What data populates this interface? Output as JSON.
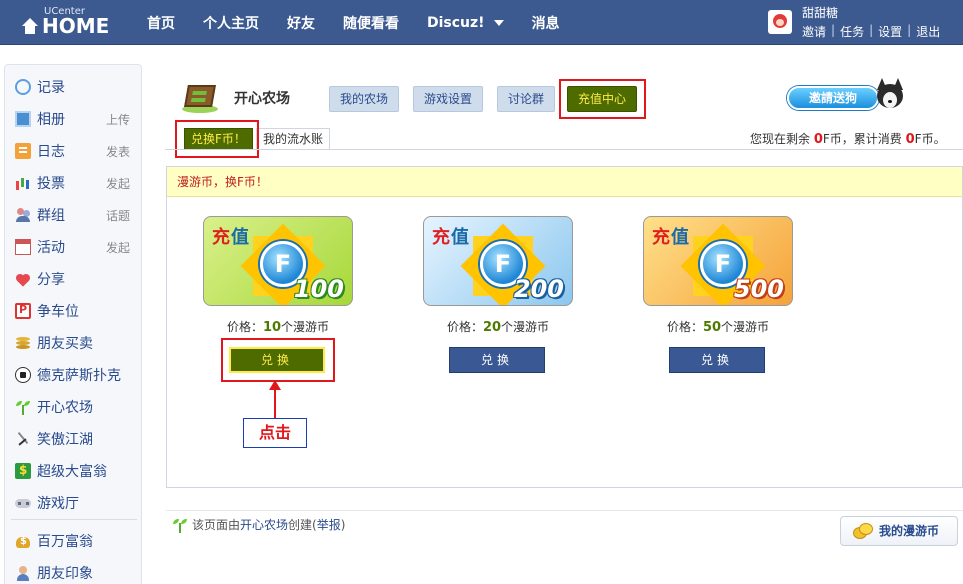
{
  "header": {
    "brand_small": "UCenter",
    "brand_large": "HOME",
    "nav": [
      {
        "label": "首页"
      },
      {
        "label": "个人主页"
      },
      {
        "label": "好友"
      },
      {
        "label": "随便看看"
      },
      {
        "label": "Discuz!"
      },
      {
        "label": "消息"
      }
    ],
    "user": {
      "name": "甜甜糖",
      "links": [
        "邀请",
        "任务",
        "设置",
        "退出"
      ]
    }
  },
  "sidebar": {
    "items": [
      {
        "label": "记录",
        "action": ""
      },
      {
        "label": "相册",
        "action": "上传"
      },
      {
        "label": "日志",
        "action": "发表"
      },
      {
        "label": "投票",
        "action": "发起"
      },
      {
        "label": "群组",
        "action": "话题"
      },
      {
        "label": "活动",
        "action": "发起"
      },
      {
        "label": "分享",
        "action": ""
      },
      {
        "label": "争车位",
        "action": ""
      },
      {
        "label": "朋友买卖",
        "action": ""
      },
      {
        "label": "德克萨斯扑克",
        "action": ""
      },
      {
        "label": "开心农场",
        "action": ""
      },
      {
        "label": "笑傲江湖",
        "action": ""
      },
      {
        "label": "超级大富翁",
        "action": ""
      },
      {
        "label": "游戏厅",
        "action": ""
      },
      {
        "label": "百万富翁",
        "action": ""
      },
      {
        "label": "朋友印象",
        "action": ""
      }
    ]
  },
  "app": {
    "title": "开心农场",
    "tabs": [
      "我的农场",
      "游戏设置",
      "讨论群",
      "充值中心"
    ],
    "active_tab": "充值中心",
    "invite_label": "邀請送狗",
    "subtabs": [
      "兑换F币！",
      "我的流水账"
    ],
    "balance": {
      "prefix": "您现在剩余",
      "remaining": "0",
      "unit1": "F币，累计消费",
      "spent": "0",
      "unit2": "F币。"
    },
    "notice": "漫游币，换F币！"
  },
  "products": [
    {
      "title_a": "充",
      "title_b": "值",
      "coin_letter": "F",
      "amount": "100",
      "price_label": "价格：",
      "price": "10",
      "price_unit": "个漫游币",
      "button": "兑换"
    },
    {
      "title_a": "充",
      "title_b": "值",
      "coin_letter": "F",
      "amount": "200",
      "price_label": "价格：",
      "price": "20",
      "price_unit": "个漫游币",
      "button": "兑换"
    },
    {
      "title_a": "充",
      "title_b": "值",
      "coin_letter": "F",
      "amount": "500",
      "price_label": "价格：",
      "price": "50",
      "price_unit": "个漫游币",
      "button": "兑换"
    }
  ],
  "annotation": {
    "click_label": "点击"
  },
  "footer": {
    "prefix": "该页面由",
    "app_link": "开心农场",
    "middle": "创建(",
    "report_link": "举报",
    "suffix": ")",
    "my_coin_button": "我的漫游币"
  },
  "colors": {
    "header_bg": "#3c5a8f",
    "active_tab_bg": "#4e6b00",
    "active_tab_text": "#ffec4a",
    "annotation_red": "#e0181b",
    "buy_button_bg": "#3a5894"
  }
}
